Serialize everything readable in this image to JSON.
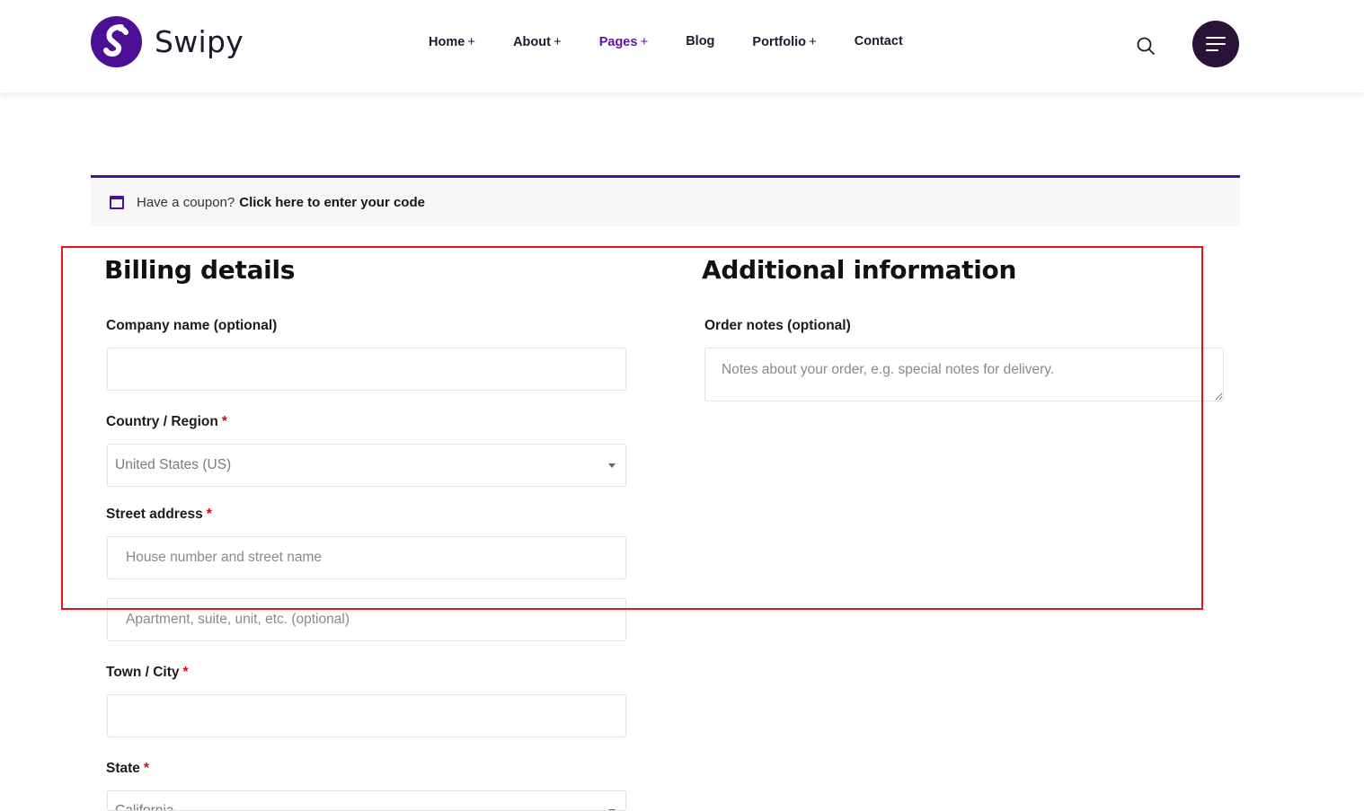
{
  "header": {
    "brand": "Swipy",
    "nav": [
      {
        "label": "Home",
        "has_plus": true,
        "active": false
      },
      {
        "label": "About",
        "has_plus": true,
        "active": false
      },
      {
        "label": "Pages",
        "has_plus": true,
        "active": true
      },
      {
        "label": "Blog",
        "has_plus": false,
        "active": false
      },
      {
        "label": "Portfolio",
        "has_plus": true,
        "active": false
      },
      {
        "label": "Contact",
        "has_plus": false,
        "active": false
      }
    ],
    "plus_symbol": "+"
  },
  "coupon": {
    "text": "Have a coupon?",
    "link": "Click here to enter your code"
  },
  "billing": {
    "title": "Billing details",
    "company_label": "Company name (optional)",
    "company_value": "",
    "country_label": "Country / Region",
    "country_value": "United States (US)",
    "street_label": "Street address",
    "street_placeholder_1": "House number and street name",
    "street_placeholder_2": "Apartment, suite, unit, etc. (optional)",
    "city_label": "Town / City",
    "city_value": "",
    "state_label": "State",
    "state_value": "California",
    "required_mark": "*"
  },
  "additional": {
    "title": "Additional information",
    "notes_label": "Order notes (optional)",
    "notes_placeholder": "Notes about your order, e.g. special notes for delivery."
  },
  "colors": {
    "brand_purple": "#4d0f96",
    "active_nav": "#5b14a8",
    "menu_button": "#2a1238",
    "required": "#e2001a",
    "annotation": "#e8141b"
  },
  "icons": {
    "search": "search-icon",
    "menu": "hamburger-menu-icon",
    "coupon": "coupon-window-icon",
    "logo": "swipy-logo-icon",
    "select_caret": "chevron-down-icon"
  }
}
